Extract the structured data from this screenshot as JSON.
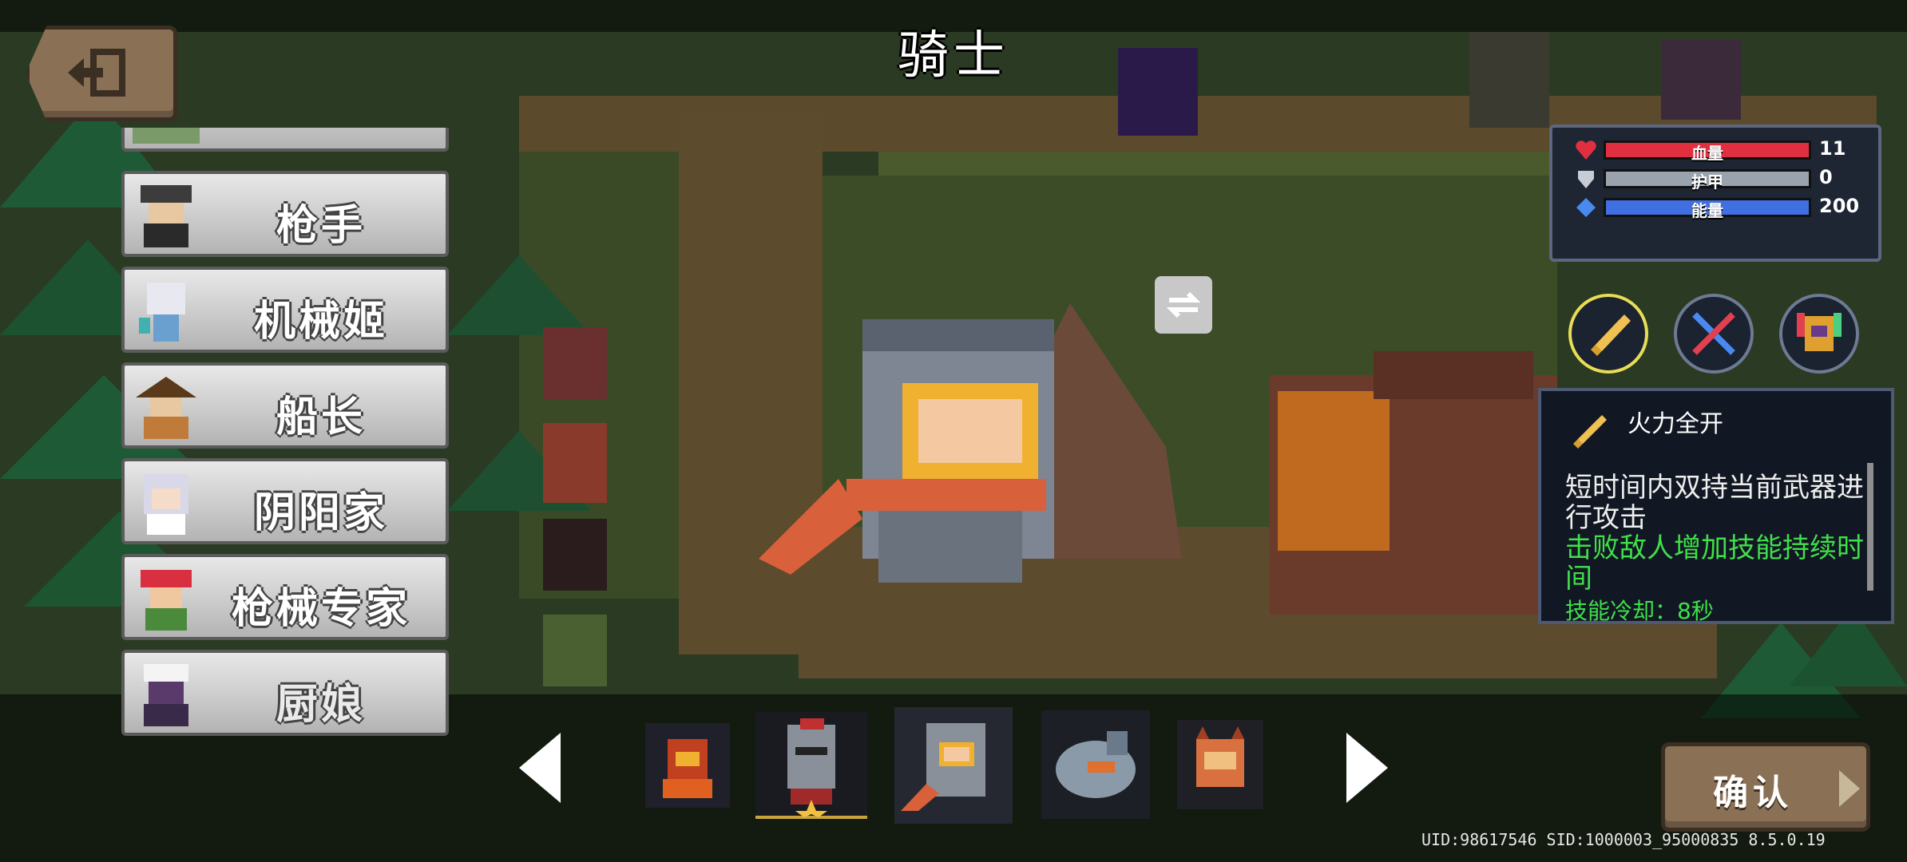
{
  "title": "骑士",
  "characters": [
    {
      "name": "枪手",
      "portrait_icon": "gunner-portrait"
    },
    {
      "name": "机械姬",
      "portrait_icon": "mech-girl-portrait"
    },
    {
      "name": "船长",
      "portrait_icon": "captain-portrait"
    },
    {
      "name": "阴阳家",
      "portrait_icon": "yinyang-portrait"
    },
    {
      "name": "枪械专家",
      "portrait_icon": "weapon-expert-portrait"
    },
    {
      "name": "厨娘",
      "portrait_icon": "chef-portrait"
    }
  ],
  "stats": {
    "hp": {
      "label": "血量",
      "value": "11",
      "color": "#e03040"
    },
    "armor": {
      "label": "护甲",
      "value": "0",
      "color": "#9aa3ad"
    },
    "energy": {
      "label": "能量",
      "value": "200",
      "color": "#3f6fe0"
    }
  },
  "skill": {
    "name": "火力全开",
    "description": "短时间内双持当前武器进行攻击",
    "bonus": "击败敌人增加技能持续时间",
    "cooldown": "技能冷却：8秒",
    "icons": [
      "dual-guns-skill-icon",
      "crossed-swords-skill-icon",
      "rainbow-helmet-skill-icon"
    ]
  },
  "skins": [
    "demon-knight-skin",
    "classic-knight-skin",
    "orange-scarf-knight-skin",
    "bird-knight-skin",
    "cat-knight-skin"
  ],
  "confirm_label": "确认",
  "uid_line": "UID:98617546 SID:1000003_95000835 8.5.0.19",
  "colors": {
    "button_brown": "#8a7155",
    "skill_green": "#3fe04a",
    "selected_gold": "#e8dd55"
  }
}
